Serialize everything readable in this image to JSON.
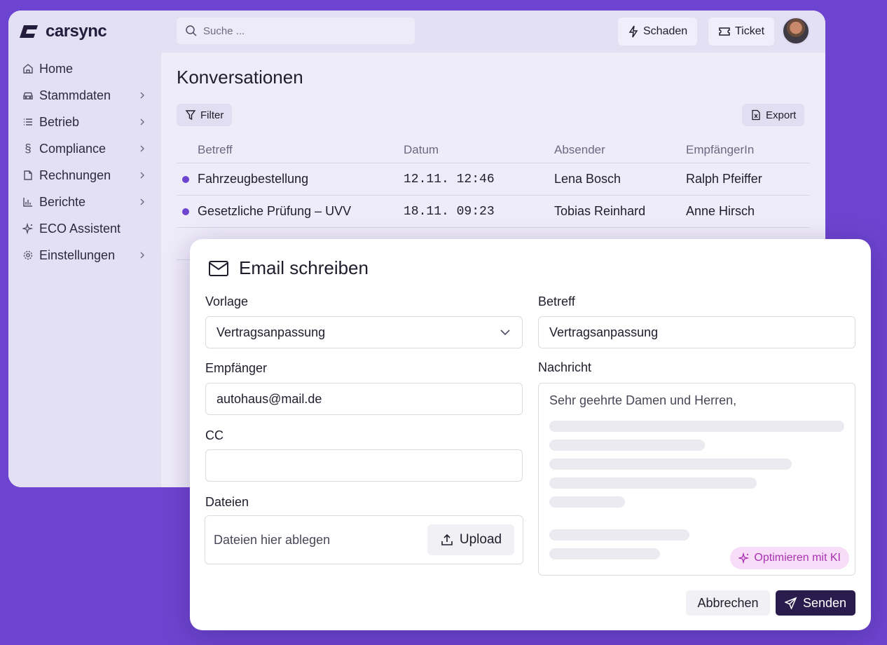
{
  "app": {
    "name": "carsync"
  },
  "sidebar": {
    "items": [
      {
        "label": "Home",
        "icon": "home-icon",
        "has_submenu": false
      },
      {
        "label": "Stammdaten",
        "icon": "car-icon",
        "has_submenu": true
      },
      {
        "label": "Betrieb",
        "icon": "list-icon",
        "has_submenu": true
      },
      {
        "label": "Compliance",
        "icon": "paragraph-icon",
        "has_submenu": true
      },
      {
        "label": "Rechnungen",
        "icon": "file-icon",
        "has_submenu": true
      },
      {
        "label": "Berichte",
        "icon": "bar-chart-icon",
        "has_submenu": true
      },
      {
        "label": "ECO Assistent",
        "icon": "sparkle-icon",
        "has_submenu": false
      },
      {
        "label": "Einstellungen",
        "icon": "gear-icon",
        "has_submenu": true
      }
    ]
  },
  "topbar": {
    "search_placeholder": "Suche ...",
    "schaden_label": "Schaden",
    "ticket_label": "Ticket"
  },
  "main": {
    "title": "Konversationen",
    "filter_label": "Filter",
    "export_label": "Export",
    "table": {
      "headers": [
        "Betreff",
        "Datum",
        "Absender",
        "EmpfängerIn"
      ],
      "rows": [
        {
          "betreff": "Fahrzeugbestellung",
          "datum": "12.11. 12:46",
          "absender": "Lena Bosch",
          "empfaenger": "Ralph Pfeiffer",
          "unread": true
        },
        {
          "betreff": "Gesetzliche Prüfung – UVV",
          "datum": "18.11. 09:23",
          "absender": "Tobias Reinhard",
          "empfaenger": "Anne Hirsch",
          "unread": true
        }
      ]
    }
  },
  "modal": {
    "title": "Email schreiben",
    "vorlage_label": "Vorlage",
    "vorlage_value": "Vertragsanpassung",
    "betreff_label": "Betreff",
    "betreff_value": "Vertragsanpassung",
    "empfaenger_label": "Empfänger",
    "empfaenger_value": "autohaus@mail.de",
    "nachricht_label": "Nachricht",
    "nachricht_value": "Sehr geehrte Damen und Herren,",
    "cc_label": "CC",
    "cc_value": "",
    "dateien_label": "Dateien",
    "drop_text": "Dateien hier ablegen",
    "upload_label": "Upload",
    "ai_label": "Optimieren mit KI",
    "cancel_label": "Abbrechen",
    "send_label": "Senden"
  },
  "colors": {
    "background": "#6d44cf",
    "accent_dot": "#6d44cf",
    "send_button": "#2a1d4e",
    "ai_button_bg": "#f7ddf8",
    "ai_button_text": "#a832b0"
  }
}
